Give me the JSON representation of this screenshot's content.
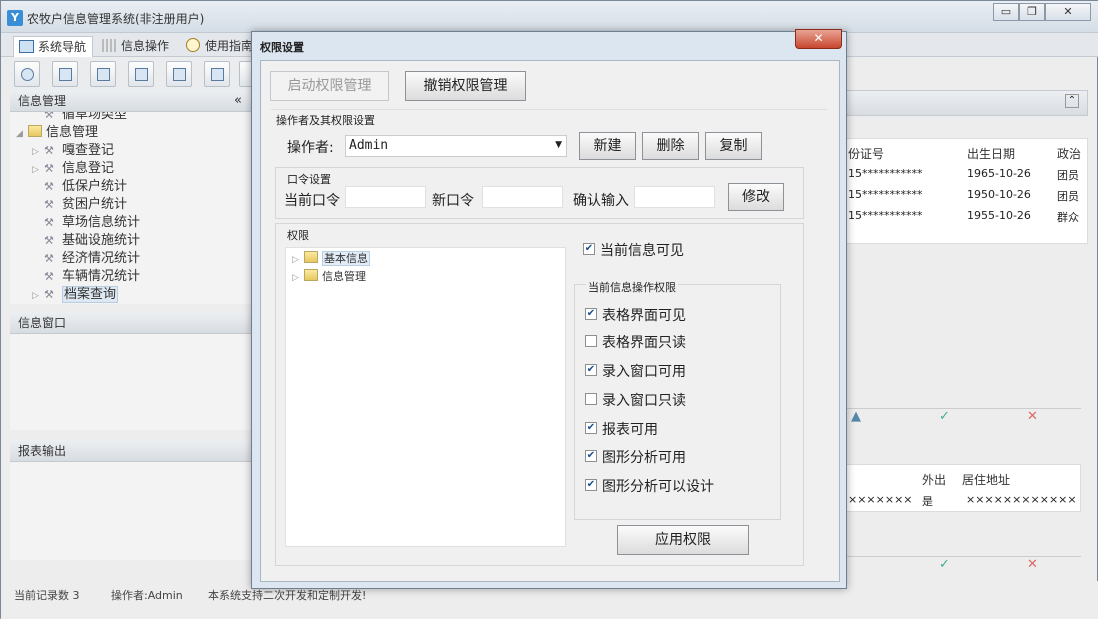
{
  "app": {
    "title": "农牧户信息管理系统(非注册用户)",
    "icon_text": "Y"
  },
  "window_controls": {
    "minimize": "▭",
    "restore": "❐",
    "close": "✕"
  },
  "tabs": [
    {
      "label": "系统导航",
      "icon": "nav-icon"
    },
    {
      "label": "信息操作",
      "icon": "grid-icon"
    },
    {
      "label": "使用指南",
      "icon": "guide-icon"
    }
  ],
  "left_panels": {
    "info_manage_title": "信息管理",
    "collapse_glyph": "«",
    "tree": [
      {
        "label": "循草场类型",
        "type": "leaf"
      },
      {
        "label": "信息管理",
        "type": "folder"
      },
      {
        "label": "嘎查登记",
        "type": "leaf"
      },
      {
        "label": "信息登记",
        "type": "leaf"
      },
      {
        "label": "低保户统计",
        "type": "leaf"
      },
      {
        "label": "贫困户统计",
        "type": "leaf"
      },
      {
        "label": "草场信息统计",
        "type": "leaf"
      },
      {
        "label": "基础设施统计",
        "type": "leaf"
      },
      {
        "label": "经济情况统计",
        "type": "leaf"
      },
      {
        "label": "车辆情况统计",
        "type": "leaf"
      },
      {
        "label": "档案查询",
        "type": "leaf"
      }
    ],
    "info_window_title": "信息窗口",
    "report_title": "报表输出"
  },
  "right_grid": {
    "headers": [
      "份证号",
      "出生日期",
      "政治"
    ],
    "rows": [
      [
        "15***********",
        "1965-10-26",
        "团员"
      ],
      [
        "15***********",
        "1950-10-26",
        "团员"
      ],
      [
        "15***********",
        "1955-10-26",
        "群众"
      ]
    ],
    "lower_headers": [
      "外出",
      "居住地址"
    ],
    "lower_row": [
      "×××××××",
      "是",
      "××××××××××××"
    ],
    "expand_glyph": "⌃"
  },
  "status": {
    "record_count": "当前记录数 3",
    "operator": "操作者:Admin",
    "support": "本系统支持二次开发和定制开发!"
  },
  "modal": {
    "title": "权限设置",
    "close_glyph": "✕",
    "enable_btn": "启动权限管理",
    "revoke_btn": "撤销权限管理",
    "section_operator": "操作者及其权限设置",
    "operator_label": "操作者:",
    "operator_value": "Admin",
    "new_btn": "新建",
    "delete_btn": "删除",
    "copy_btn": "复制",
    "section_password": "口令设置",
    "current_pwd": "当前口令",
    "new_pwd": "新口令",
    "confirm_pwd": "确认输入",
    "modify_btn": "修改",
    "section_perm": "权限",
    "perm_tree": [
      "基本信息",
      "信息管理"
    ],
    "visible_check": {
      "label": "当前信息可见",
      "checked": true
    },
    "section_ops": "当前信息操作权限",
    "ops": [
      {
        "label": "表格界面可见",
        "checked": true
      },
      {
        "label": "表格界面只读",
        "checked": false
      },
      {
        "label": "录入窗口可用",
        "checked": true
      },
      {
        "label": "录入窗口只读",
        "checked": false
      },
      {
        "label": "报表可用",
        "checked": true
      },
      {
        "label": "图形分析可用",
        "checked": true
      },
      {
        "label": "图形分析可以设计",
        "checked": true
      }
    ],
    "apply_btn": "应用权限"
  }
}
